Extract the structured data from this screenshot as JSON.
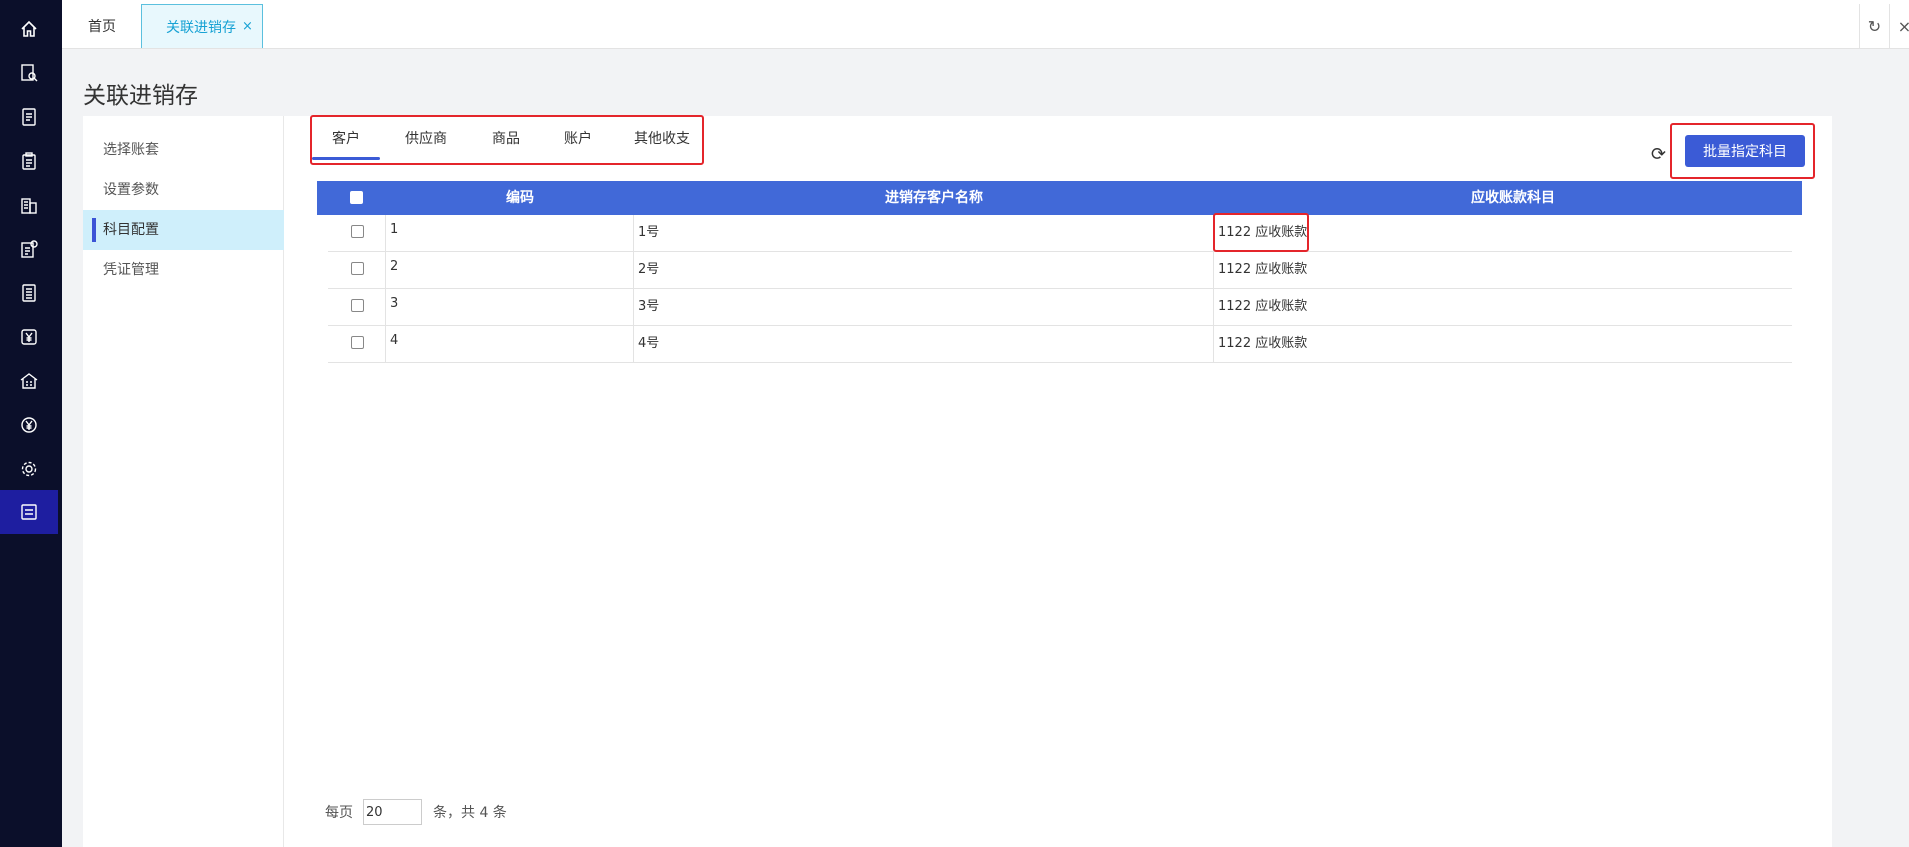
{
  "rail": {
    "icons": [
      "home-icon",
      "search-document-icon",
      "list-document-icon",
      "clipboard-icon",
      "building-icon",
      "document-settings-icon",
      "ledger-icon",
      "yen-document-icon",
      "warehouse-icon",
      "yen-circle-icon",
      "gear-icon",
      "ledger-active-icon"
    ]
  },
  "topbar": {
    "home_tab": "首页",
    "active_tab": "关联进销存",
    "close_glyph": "×",
    "refresh_glyph": "↻",
    "close_all_glyph": "×"
  },
  "page": {
    "title": "关联进销存"
  },
  "sidenav": {
    "items": [
      {
        "label": "选择账套",
        "active": false
      },
      {
        "label": "设置参数",
        "active": false
      },
      {
        "label": "科目配置",
        "active": true
      },
      {
        "label": "凭证管理",
        "active": false
      }
    ]
  },
  "subtabs": [
    {
      "label": "客户",
      "active": true
    },
    {
      "label": "供应商",
      "active": false
    },
    {
      "label": "商品",
      "active": false
    },
    {
      "label": "账户",
      "active": false
    },
    {
      "label": "其他收支",
      "active": false
    }
  ],
  "toolbar": {
    "batch_label": "批量指定科目",
    "refresh_glyph": "⟳"
  },
  "table": {
    "columns": [
      "编码",
      "进销存客户名称",
      "应收账款科目"
    ],
    "rows": [
      {
        "code": "1",
        "name": "1号",
        "account": "1122 应收账款"
      },
      {
        "code": "2",
        "name": "2号",
        "account": "1122 应收账款"
      },
      {
        "code": "3",
        "name": "3号",
        "account": "1122 应收账款"
      },
      {
        "code": "4",
        "name": "4号",
        "account": "1122 应收账款"
      }
    ]
  },
  "pager": {
    "prefix": "每页",
    "page_size": "20",
    "suffix": "条，共 4 条"
  },
  "colors": {
    "accent": "#3b5bd6",
    "table_header": "#4169d8",
    "highlight": "#e4252b",
    "rail_bg": "#0b0f2a"
  }
}
